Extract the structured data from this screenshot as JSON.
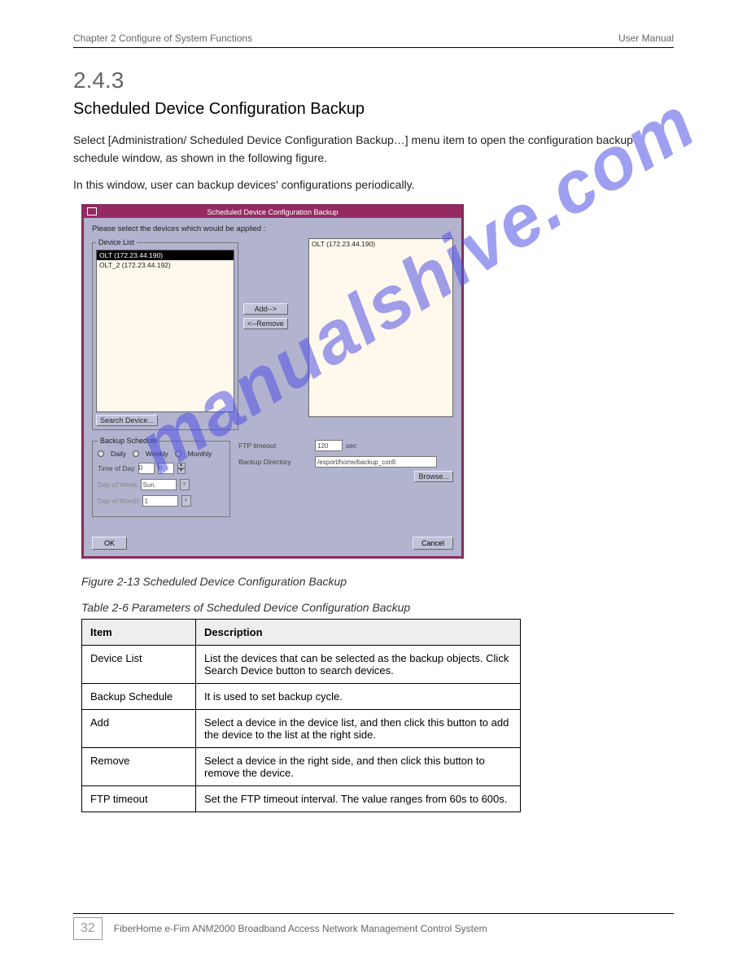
{
  "header": {
    "left": "Chapter 2 Configure of System Functions",
    "right": "User Manual"
  },
  "section": {
    "number": "2.4.3",
    "title": "Scheduled Device Configuration Backup",
    "para1": "Select [Administration/ Scheduled Device Configuration Backup…] menu item to open the configuration backup schedule window, as shown in the following figure.",
    "para2": "In this window, user can backup devices' configurations periodically."
  },
  "dialog": {
    "title": "Scheduled Device Configuration Backup",
    "instruction": "Please select the devices which would be applied :",
    "device_list_legend": "Device List",
    "left_items": [
      {
        "label": "OLT (172.23.44.190)",
        "selected": true
      },
      {
        "label": "OLT_2 (172.23.44.192)",
        "selected": false
      }
    ],
    "right_items": [
      "OLT (172.23.44.190)"
    ],
    "add_label": "Add-->",
    "remove_label": "<--Remove",
    "search_label": "Search Device...",
    "schedule_legend": "Backup Schedule",
    "radios": {
      "daily": "Daily",
      "weekly": "Weekly",
      "monthly": "Monthly"
    },
    "time_of_day_label": "Time of Day",
    "time_hour": "0",
    "time_min": "0",
    "day_of_week_label": "Day of Week",
    "day_of_week_value": "Sun.",
    "day_of_month_label": "Day of Month",
    "day_of_month_value": "1",
    "ftp_timeout_label": "FTP timeout",
    "ftp_timeout_value": "120",
    "ftp_timeout_unit": "sec",
    "backup_dir_label": "Backup Directory",
    "backup_dir_value": "/export/home/backup_confi",
    "browse_label": "Browse...",
    "ok_label": "OK",
    "cancel_label": "Cancel"
  },
  "figure": {
    "caption": "Figure 2-13 Scheduled Device Configuration Backup"
  },
  "table": {
    "caption": "Table 2-6 Parameters of Scheduled Device Configuration Backup",
    "head_item": "Item",
    "head_desc": "Description",
    "rows": [
      {
        "item": "Device List",
        "desc": "List the devices that can be selected as the backup objects. Click Search Device button to search devices."
      },
      {
        "item": "Backup Schedule",
        "desc": "It is used to set backup cycle."
      },
      {
        "item": "Add",
        "desc": "Select a device in the device list, and then click this button to add the device to the list at the right side."
      },
      {
        "item": "Remove",
        "desc": "Select a device in the right side, and then click this button to remove the device."
      },
      {
        "item": "FTP timeout",
        "desc": "Set the FTP timeout interval. The value ranges from 60s to 600s."
      }
    ]
  },
  "footer": {
    "page_number": "32",
    "doc": "FiberHome e-Fim ANM2000 Broadband Access Network Management Control System"
  },
  "watermark": "manualshive.com"
}
